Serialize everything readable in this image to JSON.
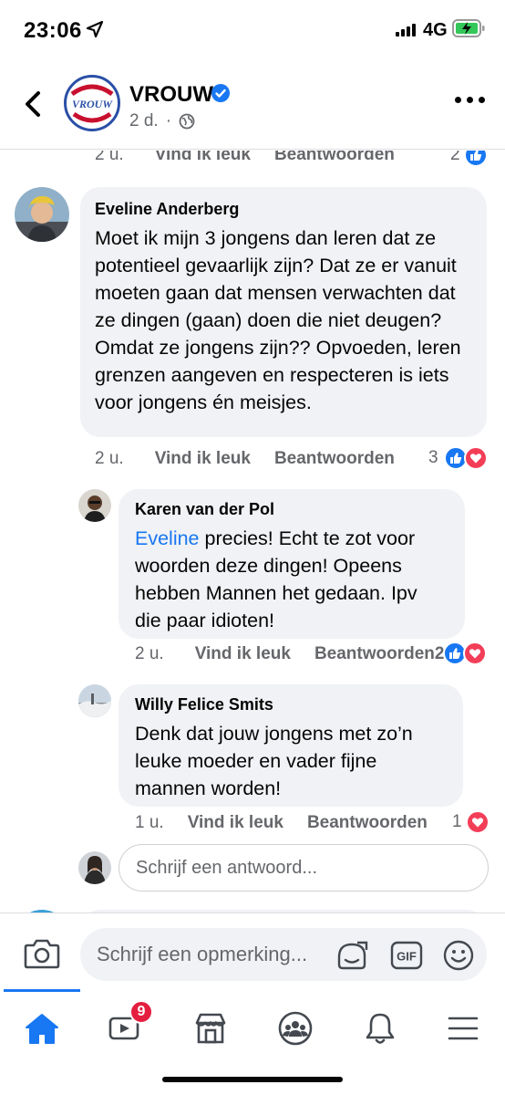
{
  "status_bar": {
    "time": "23:06",
    "network": "4G"
  },
  "header": {
    "page_name": "VROUW",
    "logo_text": "VROUW",
    "meta": "2 d."
  },
  "top_action_row": {
    "time": "2 u.",
    "like": "Vind ik leuk",
    "reply": "Beantwoorden",
    "reaction_count": "2"
  },
  "comments": [
    {
      "name": "Eveline Anderberg",
      "text": "Moet ik mijn 3 jongens dan leren dat ze potentieel gevaarlijk zijn? Dat ze er vanuit moeten gaan dat mensen verwachten dat ze dingen (gaan) doen die niet deugen? Omdat ze jongens zijn?? Opvoeden, leren grenzen aangeven en respecteren is iets voor jongens én meisjes.",
      "time": "2 u.",
      "like": "Vind ik leuk",
      "reply": "Beantwoorden",
      "reaction_count": "3"
    },
    {
      "name": "Karen van der Pol",
      "mention": "Eveline",
      "text": " precies! Echt te zot voor woorden deze dingen! Opeens hebben Mannen het gedaan. Ipv die paar idioten!",
      "time": "2 u.",
      "like": "Vind ik leuk",
      "reply": "Beantwoorden",
      "reaction_count": "2"
    },
    {
      "name": "Willy Felice Smits",
      "text": "Denk dat jouw jongens met zo’n leuke moeder en vader fijne mannen worden!",
      "time": "1 u.",
      "like": "Vind ik leuk",
      "reply": "Beantwoorden",
      "reaction_count": "1"
    }
  ],
  "reply_placeholder": "Schrijf een antwoord...",
  "composer": {
    "placeholder": "Schrijf een opmerking...",
    "gif_label": "GIF"
  },
  "tabbar": {
    "watch_badge": "9"
  },
  "colors": {
    "accent": "#1877f2",
    "love": "#f33e58",
    "badge": "#e41e3f"
  }
}
